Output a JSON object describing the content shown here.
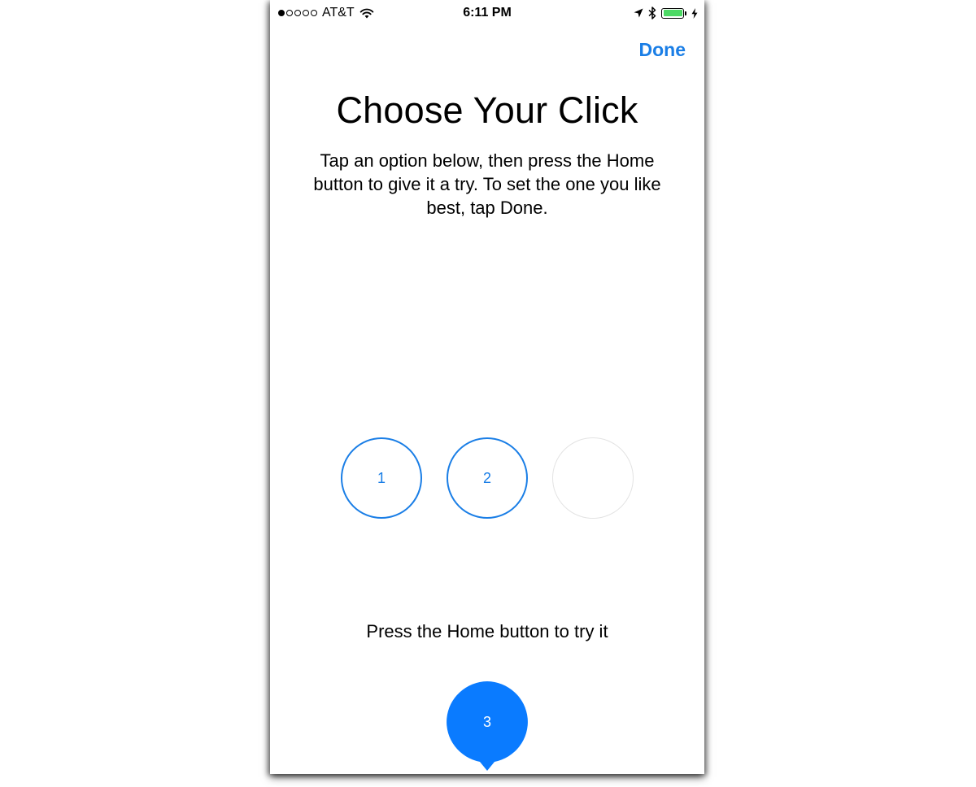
{
  "status_bar": {
    "carrier": "AT&T",
    "time": "6:11 PM",
    "signal_bars_filled": 1,
    "signal_bars_total": 5,
    "battery_level": 1.0,
    "icons": [
      "wifi-icon",
      "location-arrow-icon",
      "bluetooth-icon",
      "battery-icon",
      "charging-bolt-icon"
    ]
  },
  "nav": {
    "done_label": "Done"
  },
  "main": {
    "title": "Choose Your Click",
    "instructions": "Tap an option below, then press the Home button to give it a try. To set the one you like best, tap Done.",
    "options": [
      {
        "label": "1"
      },
      {
        "label": "2"
      },
      {
        "label": ""
      }
    ],
    "hint": "Press the Home button to try it",
    "dragged_option": {
      "label": "3"
    }
  },
  "colors": {
    "accent": "#1a7ee6",
    "bubble": "#0a7bff",
    "battery": "#4cd964",
    "empty_border": "#e3e3e3"
  }
}
